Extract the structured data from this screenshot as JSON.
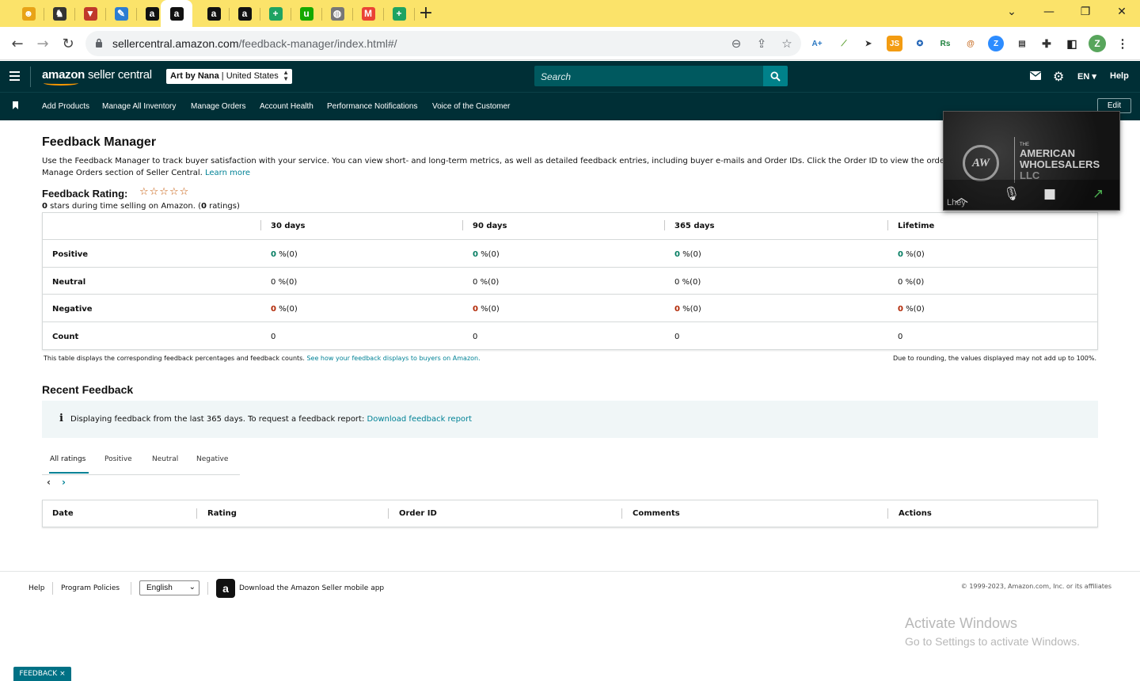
{
  "browser": {
    "tabs": [
      {
        "icon": "honey-icon",
        "color": "#e8a317",
        "glyph": "☻"
      },
      {
        "icon": "puzzle-shield-icon",
        "color": "#333333",
        "glyph": "♞"
      },
      {
        "icon": "triangle-red-icon",
        "color": "#c0392b",
        "glyph": "▼"
      },
      {
        "icon": "pencil-icon",
        "color": "#2d7dd2",
        "glyph": "✎"
      },
      {
        "icon": "amazon-icon",
        "color": "#111111",
        "glyph": "a"
      },
      {
        "icon": "amazon-icon",
        "color": "#111111",
        "glyph": "a"
      },
      {
        "icon": "amazon-icon",
        "color": "#111111",
        "glyph": "a"
      },
      {
        "icon": "amazon-icon",
        "color": "#111111",
        "glyph": "a"
      },
      {
        "icon": "sheets-icon",
        "color": "#1ea362",
        "glyph": "+"
      },
      {
        "icon": "upwork-icon",
        "color": "#14a800",
        "glyph": "u"
      },
      {
        "icon": "globe-icon",
        "color": "#777777",
        "glyph": "◍"
      },
      {
        "icon": "gmail-icon",
        "color": "#ea4335",
        "glyph": "M"
      },
      {
        "icon": "sheets-icon",
        "color": "#1ea362",
        "glyph": "+"
      }
    ],
    "active_tab_index": 5,
    "new_tab": "+",
    "url_host": "sellercentral.amazon.com",
    "url_path": "/feedback-manager/index.html#/",
    "profile_initial": "Z"
  },
  "header": {
    "logo_text": "amazon",
    "logo_suffix": "seller central",
    "store_name": "Art by Nana",
    "store_region": "United States",
    "search_placeholder": "Search",
    "language": "EN",
    "help": "Help"
  },
  "nav": {
    "links": [
      "Add Products",
      "Manage All Inventory",
      "Manage Orders",
      "Account Health",
      "Performance Notifications",
      "Voice of the Customer"
    ],
    "edit": "Edit"
  },
  "page": {
    "title": "Feedback Manager",
    "intro": "Use the Feedback Manager to track buyer satisfaction with your service. You can view short- and long-term metrics, as well as detailed feedback entries, including buyer e-mails and Order IDs. Click the Order ID to view the order in the Manage Orders section of Seller Central.",
    "learn_more": "Learn more",
    "rating_label": "Feedback Rating:",
    "stars": "☆☆☆☆☆",
    "rating_stars_value": "0",
    "rating_text_mid": " stars during time selling on Amazon. (",
    "rating_count": "0",
    "rating_text_end": " ratings)"
  },
  "metrics": {
    "columns": [
      "30 days",
      "90 days",
      "365 days",
      "Lifetime"
    ],
    "rows": [
      {
        "label": "Positive",
        "color": "green",
        "values": [
          "0",
          "0",
          "0",
          "0"
        ],
        "suffix": "%(0)"
      },
      {
        "label": "Neutral",
        "color": "plain",
        "values": [
          "0",
          "0",
          "0",
          "0"
        ],
        "suffix": "%(0)"
      },
      {
        "label": "Negative",
        "color": "red",
        "values": [
          "0",
          "0",
          "0",
          "0"
        ],
        "suffix": "%(0)"
      },
      {
        "label": "Count",
        "color": "plain",
        "values": [
          "0",
          "0",
          "0",
          "0"
        ],
        "suffix": ""
      }
    ],
    "note_left": "This table displays the corresponding feedback percentages and feedback counts.",
    "note_link": "See how your feedback displays to buyers on Amazon.",
    "note_right": "Due to rounding, the values displayed may not add up to 100%."
  },
  "recent": {
    "title": "Recent Feedback",
    "info_text": "Displaying feedback from the last 365 days. To request a feedback report:",
    "info_link": "Download feedback report",
    "tabs": [
      "All ratings",
      "Positive",
      "Neutral",
      "Negative"
    ],
    "active_tab": "All ratings",
    "columns": [
      "Date",
      "Rating",
      "Order ID",
      "Comments",
      "Actions"
    ]
  },
  "footer": {
    "help": "Help",
    "policies": "Program Policies",
    "language": "English",
    "app_text": "Download the Amazon Seller mobile app",
    "copyright": "© 1999-2023, Amazon.com, Inc. or its affiliates"
  },
  "watermark": {
    "line1": "Activate Windows",
    "line2": "Go to Settings to activate Windows."
  },
  "feedback_tab": "FEEDBACK ×",
  "video_overlay": {
    "logo": "AW",
    "brand_small": "THE",
    "brand_line1": "AMERICAN",
    "brand_line2": "WHOLESALERS",
    "brand_line3": "LLC",
    "caption": "Lhey"
  }
}
